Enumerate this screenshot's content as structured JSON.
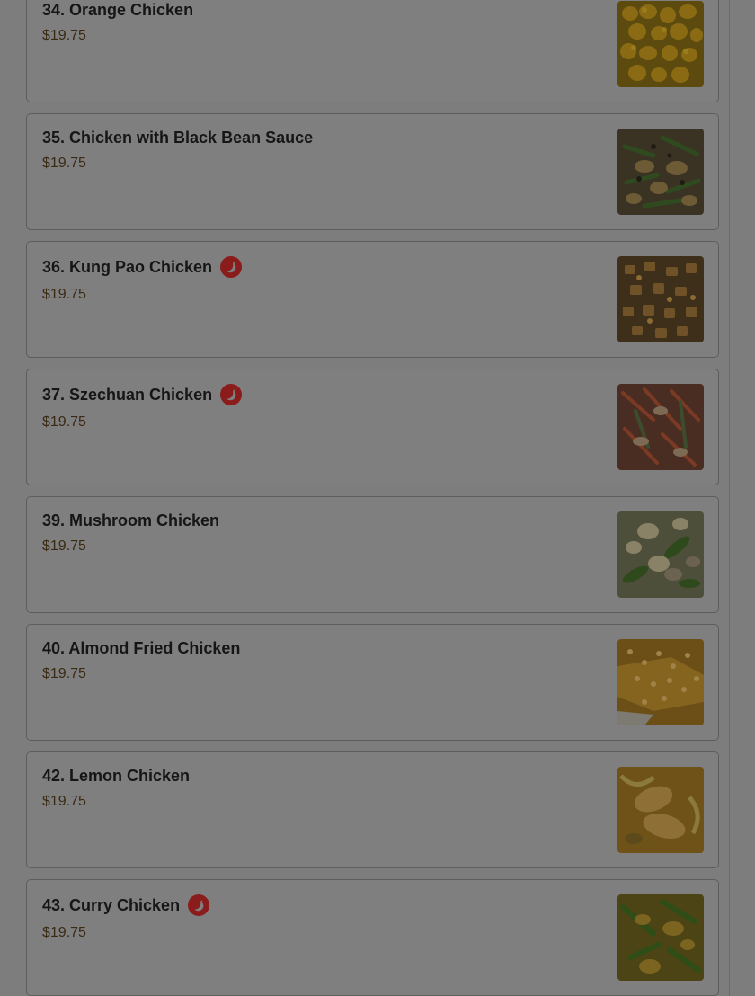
{
  "menu": {
    "items": [
      {
        "name": "34. Orange Chicken",
        "price": "$19.75",
        "spicy": false,
        "image": "orange-chicken-photo"
      },
      {
        "name": "35. Chicken with Black Bean Sauce",
        "price": "$19.75",
        "spicy": false,
        "image": "black-bean-chicken-photo"
      },
      {
        "name": "36. Kung Pao Chicken",
        "price": "$19.75",
        "spicy": true,
        "image": "kung-pao-chicken-photo"
      },
      {
        "name": "37. Szechuan Chicken",
        "price": "$19.75",
        "spicy": true,
        "image": "szechuan-chicken-photo"
      },
      {
        "name": "39. Mushroom Chicken",
        "price": "$19.75",
        "spicy": false,
        "image": "mushroom-chicken-photo"
      },
      {
        "name": "40. Almond Fried Chicken",
        "price": "$19.75",
        "spicy": false,
        "image": "almond-fried-chicken-photo"
      },
      {
        "name": "42. Lemon Chicken",
        "price": "$19.75",
        "spicy": false,
        "image": "lemon-chicken-photo"
      },
      {
        "name": "43. Curry Chicken",
        "price": "$19.75",
        "spicy": true,
        "image": "curry-chicken-photo"
      }
    ]
  },
  "icons": {
    "spicy": "chili-pepper-icon"
  },
  "colors": {
    "overlay": "#7d7d7d",
    "spicy_badge": "#8a1c1c",
    "price": "#3a2a14"
  }
}
